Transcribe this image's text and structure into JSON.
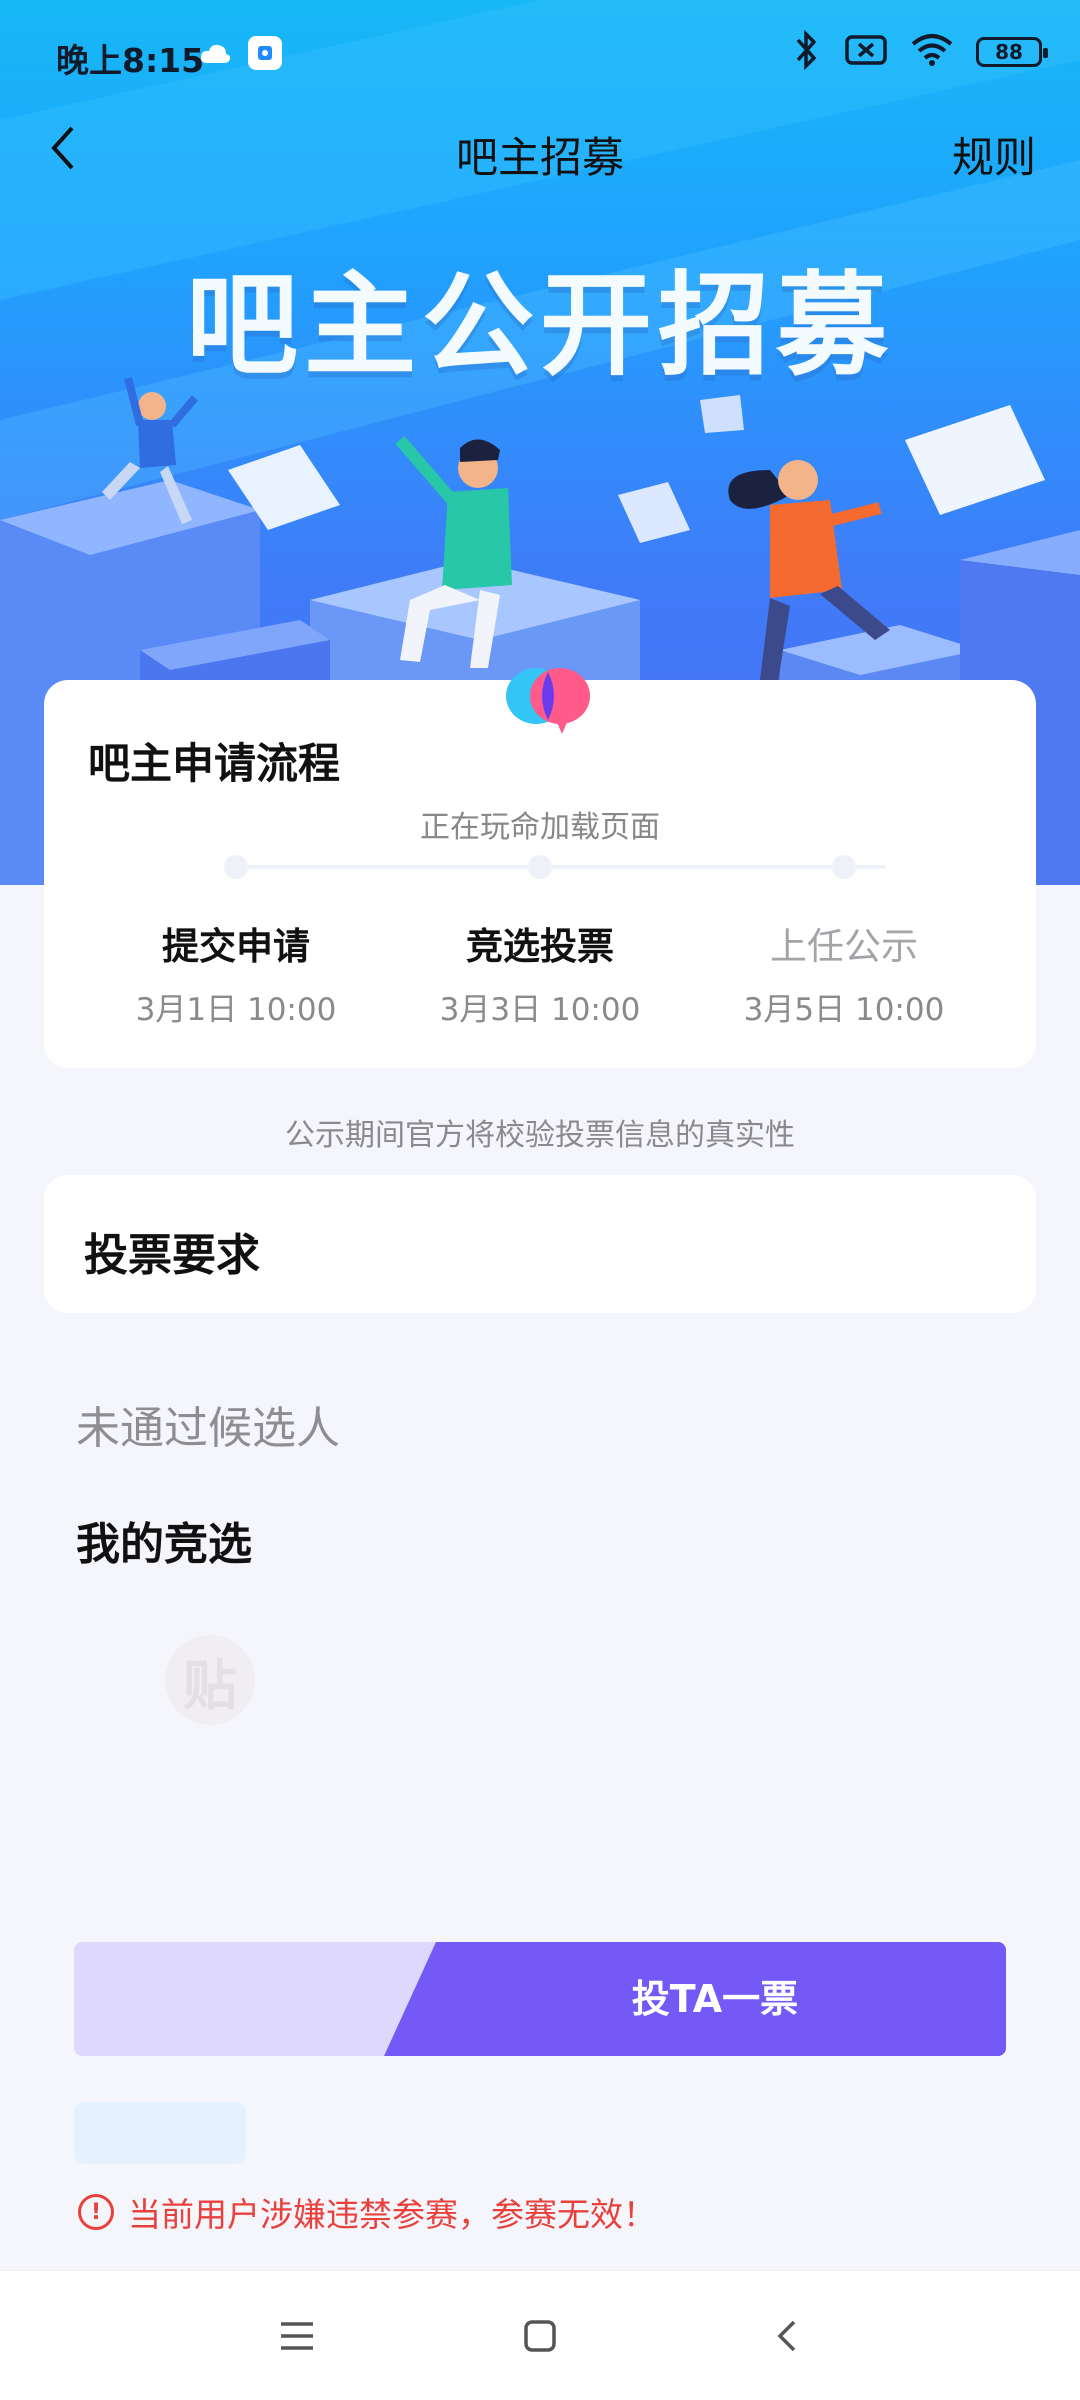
{
  "status_bar": {
    "time": "晚上8:15",
    "battery": "88",
    "icons": [
      "cloud-icon",
      "app-notification-icon",
      "bluetooth-icon",
      "sim-off-icon",
      "wifi-icon",
      "battery-icon"
    ]
  },
  "header": {
    "title": "吧主招募",
    "rules_label": "规则",
    "back_icon": "chevron-left-icon"
  },
  "banner": {
    "title": "吧主公开招募"
  },
  "process": {
    "title": "吧主申请流程",
    "loading_text": "正在玩命加载页面",
    "steps": [
      {
        "label": "提交申请",
        "date": "3月1日 10:00"
      },
      {
        "label": "竞选投票",
        "date": "3月3日 10:00"
      },
      {
        "label": "上任公示",
        "date": "3月5日 10:00"
      }
    ]
  },
  "verify_note": "公示期间官方将校验投票信息的真实性",
  "vote_requirements": {
    "title": "投票要求"
  },
  "sections": {
    "failed_candidates": "未通过候选人",
    "my_campaign": "我的竞选"
  },
  "tieba_placeholder": "贴",
  "vote_button": {
    "label": "投TA一票"
  },
  "warning": {
    "icon": "!",
    "text": "当前用户涉嫌违禁参赛，参赛无效！"
  },
  "colors": {
    "accent_purple": "#7559f7",
    "light_purple": "#ddd8fc",
    "warning_red": "#e8413c",
    "hero_blue": "#1fa3ff"
  }
}
